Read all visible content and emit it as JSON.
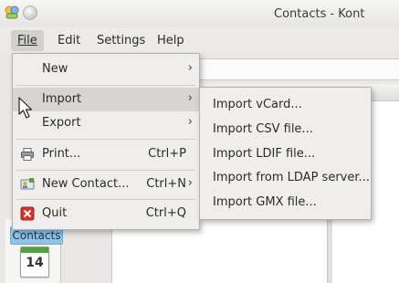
{
  "window": {
    "title": "Contacts - Kont"
  },
  "menubar": {
    "items": [
      "File",
      "Edit",
      "Settings",
      "Help"
    ]
  },
  "file_menu": {
    "items": [
      {
        "label": "New",
        "has_submenu": true,
        "shortcut": ""
      },
      {
        "label": "Import",
        "has_submenu": true,
        "shortcut": ""
      },
      {
        "label": "Export",
        "has_submenu": true,
        "shortcut": ""
      },
      {
        "label": "Print...",
        "has_submenu": false,
        "shortcut": "Ctrl+P",
        "icon": "printer-icon"
      },
      {
        "label": "New Contact...",
        "has_submenu": true,
        "shortcut": "Ctrl+N",
        "icon": "new-contact-icon"
      },
      {
        "label": "Quit",
        "has_submenu": false,
        "shortcut": "Ctrl+Q",
        "icon": "quit-icon"
      }
    ],
    "arrow": "›"
  },
  "import_menu": {
    "items": [
      "Import vCard...",
      "Import CSV file...",
      "Import LDIF file...",
      "Import from LDAP server...",
      "Import GMX file..."
    ]
  },
  "sidebar": {
    "contacts_label": "Contacts",
    "calendar_day": "14"
  },
  "colors": {
    "menu_bg": "#efeeec",
    "highlight": "#d6d5d2",
    "contacts_accent": "#8fc4e6",
    "quit_red": "#d9302b",
    "calendar_green": "#4aa43f"
  }
}
